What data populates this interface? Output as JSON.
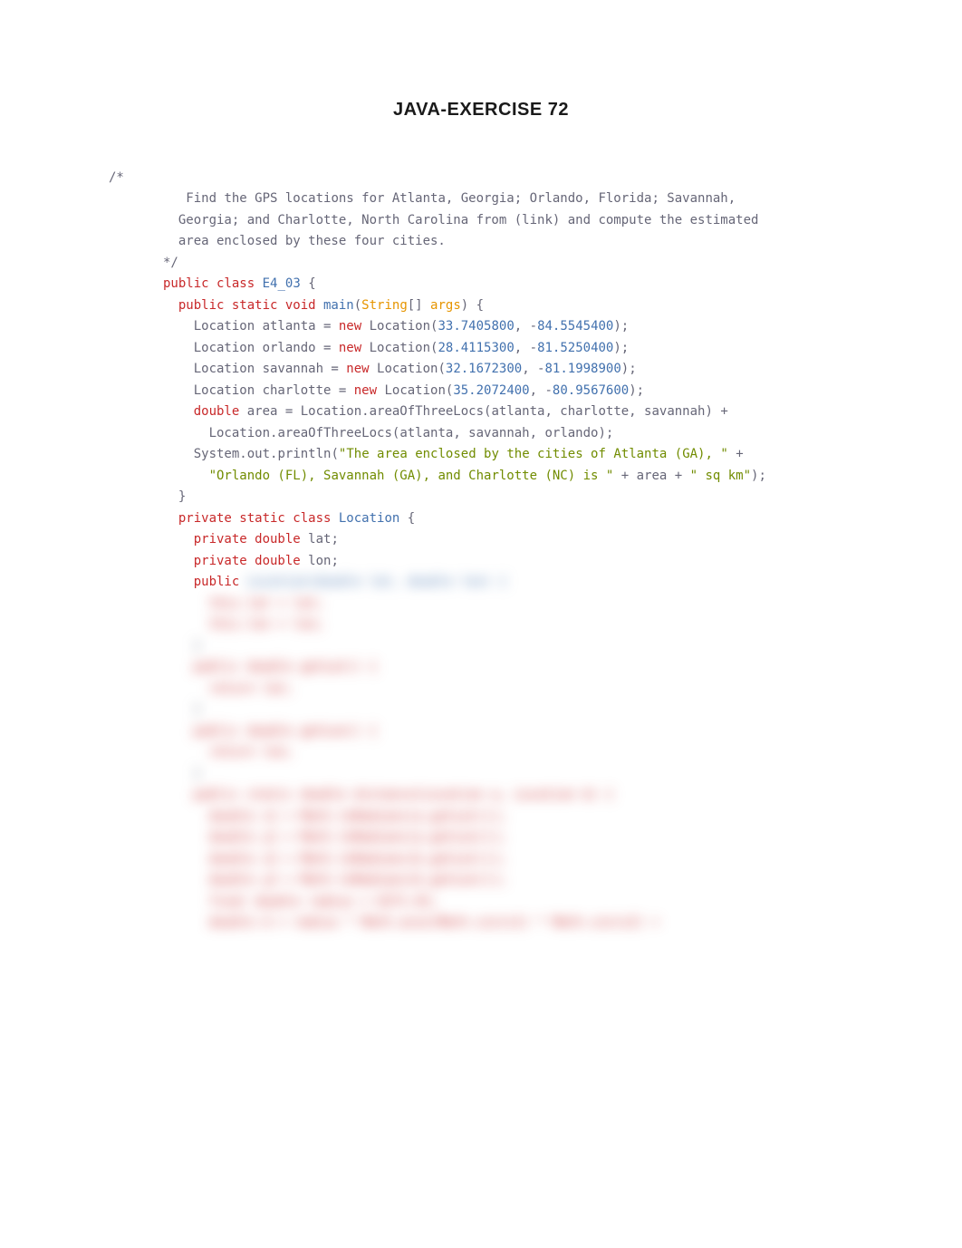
{
  "title": "JAVA-EXERCISE 72",
  "comment_open": "/*",
  "comment_body": "   Find the GPS locations for Atlanta, Georgia; Orlando, Florida; Savannah,\n  Georgia; and Charlotte, North Carolina from (link) and compute the estimated\n  area enclosed by these four cities.\n*/",
  "code": {
    "class_decl_pre": "public",
    "class_kw": "class",
    "class_name": "E4_03",
    "class_open": " {",
    "main_sig_pre": "  public static void",
    "main_name": " main",
    "main_paren_open": "(",
    "main_string": "String",
    "main_arr": "[] ",
    "main_args": "args",
    "main_paren_close": ") {",
    "l_atlanta_a": "    Location atlanta = ",
    "l_new": "new",
    "l_atlanta_b": " Location(",
    "l_atlanta_lat": "33.7405800",
    "l_sep": ", -",
    "l_atlanta_lon": "84.5545400",
    "l_close": ");",
    "l_orlando_a": "    Location orlando = ",
    "l_orlando_b": " Location(",
    "l_orlando_lat": "28.4115300",
    "l_orlando_lon": "81.5250400",
    "l_savannah_a": "    Location savannah = ",
    "l_savannah_b": " Location(",
    "l_savannah_lat": "32.1672300",
    "l_savannah_lon": "81.1998900",
    "l_charlotte_a": "    Location charlotte = ",
    "l_charlotte_b": " Location(",
    "l_charlotte_lat": "35.2072400",
    "l_charlotte_lon": "80.9567600",
    "area_pre": "    ",
    "area_double": "double",
    "area_mid": " area = Location",
    "area_dot": ".",
    "area_call1": "areaOfThreeLocs(atlanta, charlotte, savannah) ",
    "area_plus": "+",
    "area_call2_pre": "      Location",
    "area_call2": "areaOfThreeLocs(atlanta, savannah, orlando);",
    "sys_pre": "    System",
    "sys_out": "out",
    "sys_println": "println(",
    "str1": "\"The area enclosed by the cities of Atlanta (GA), \"",
    "str1_plus": " +",
    "str2_pre": "      ",
    "str2": "\"Orlando (FL), Savannah (GA), and Charlotte (NC) is \"",
    "str2_mid": " + area + ",
    "str3": "\" sq km\"",
    "str_close": ");",
    "brace_close1": "  }",
    "inner_pre": "  private static class",
    "inner_name": " Location",
    "inner_open": " {",
    "lat_pre": "    private double",
    "lat_name": " lat;",
    "lon_pre": "    private double",
    "lon_name": " lon;",
    "ctor_pre": "    public"
  },
  "blurred": {
    "ctor_sig": " Location(double lat, double lon) {",
    "ctor_b1": "      this.lat = lat;",
    "ctor_b2": "      this.lon = lon;",
    "ctor_close": "    }",
    "getlat_sig": "    public double getLat() {",
    "getlat_b": "      return lat;",
    "getlat_close": "    }",
    "getlon_sig": "    public double getLon() {",
    "getlon_b": "      return lon;",
    "getlon_close": "    }",
    "dist_sig": "    public static double distance(Location a, Location b) {",
    "dist_b1": "      double x1 = Math.toRadians(a.getLat());",
    "dist_b2": "      double y1 = Math.toRadians(a.getLon());",
    "dist_b3": "      double x2 = Math.toRadians(b.getLat());",
    "dist_b4": "      double y2 = Math.toRadians(b.getLon());",
    "dist_b5": "      final double radius = 6371.01;",
    "dist_b6": "      double d = radius * Math.acos(Math.sin(x1) * Math.sin(x2) +"
  }
}
